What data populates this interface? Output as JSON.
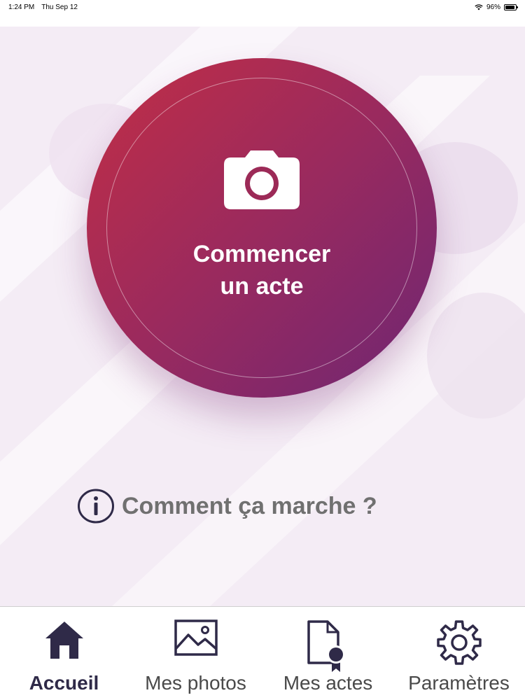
{
  "status_bar": {
    "time": "1:24 PM",
    "date": "Thu Sep 12",
    "wifi_icon": "wifi-icon",
    "battery_percent": "96%",
    "battery_level": 0.96
  },
  "home": {
    "start_button": {
      "icon": "camera-icon",
      "label": "Commencer\nun acte",
      "gradient": [
        "#c22e45",
        "#6e2673"
      ]
    },
    "how_it_works": {
      "icon": "info-icon",
      "label": "Comment ça marche ?"
    }
  },
  "tab_bar": {
    "active_color": "#2f2a48",
    "tabs": [
      {
        "label": "Accueil",
        "icon": "home-icon",
        "active": true
      },
      {
        "label": "Mes photos",
        "icon": "image-icon",
        "active": false
      },
      {
        "label": "Mes actes",
        "icon": "certified-document-icon",
        "active": false
      },
      {
        "label": "Paramètres",
        "icon": "gear-icon",
        "active": false
      }
    ]
  }
}
